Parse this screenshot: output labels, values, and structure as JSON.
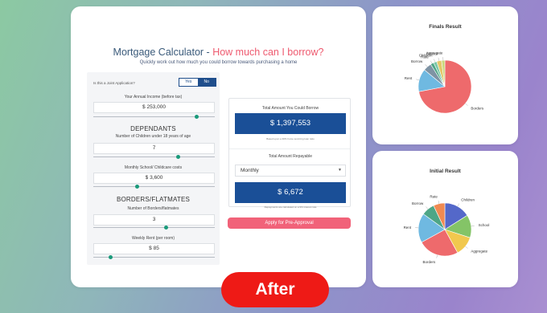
{
  "calculator": {
    "title_main": "Mortgage Calculator - ",
    "title_accent": "How much can I borrow?",
    "subtitle": "Quickly work out how much you could borrow towards purchasing a home",
    "joint_label": "Is this a Joint Application?",
    "yes_label": "Yes",
    "no_label": "No",
    "income_label": "Your Annual Income (before tax)",
    "income_value": "$ 253,000",
    "income_slider": 0.85,
    "dependants_heading": "DEPENDANTS",
    "children_label": "Number of Children under 18 years of age",
    "children_value": "7",
    "children_slider": 0.7,
    "childcare_label": "Monthly School/ Childcare costs",
    "childcare_value": "$ 3,600",
    "childcare_slider": 0.36,
    "borders_heading": "BORDERS/FLATMATES",
    "borders_label": "Number of Borders/flatmates",
    "borders_value": "3",
    "borders_slider": 0.6,
    "rent_label": "Weekly Rent (per room)",
    "rent_value": "$ 85",
    "rent_slider": 0.14
  },
  "results": {
    "borrow_label": "Total Amount You Could Borrow",
    "borrow_value": "$ 1,397,553",
    "borrow_note": "Based upon a 30% home servicing loan ratio",
    "repay_label": "Total Amount Repayable",
    "frequency": "Monthly",
    "repay_value": "$ 6,672",
    "repay_note": "Repayments are calculated on a 9% interest rate",
    "apply_label": "Apply for Pre-Approval"
  },
  "after_label": "After",
  "chart_data": [
    {
      "type": "pie",
      "title": "Finals Result",
      "labels": [
        "Borders",
        "Rent",
        "Borrow",
        "Rate",
        "Children",
        "School",
        "Aggregate"
      ],
      "values": [
        72,
        14,
        5,
        2,
        2,
        3,
        2
      ],
      "colors": [
        "#ee6a6c",
        "#6fb9e1",
        "#7e93a4",
        "#4ea686",
        "#7bc8a8",
        "#e4c86a",
        "#c9d87a"
      ]
    },
    {
      "type": "pie",
      "title": "Initial Result",
      "labels": [
        "Children",
        "School",
        "Aggregate",
        "Borders",
        "Rent",
        "Borrow",
        "Rate"
      ],
      "values": [
        16,
        14,
        12,
        25,
        18,
        8,
        7
      ],
      "colors": [
        "#5468c9",
        "#84c467",
        "#f1c84e",
        "#ee6a6c",
        "#6fb9e1",
        "#4ea686",
        "#f08a52"
      ]
    }
  ]
}
